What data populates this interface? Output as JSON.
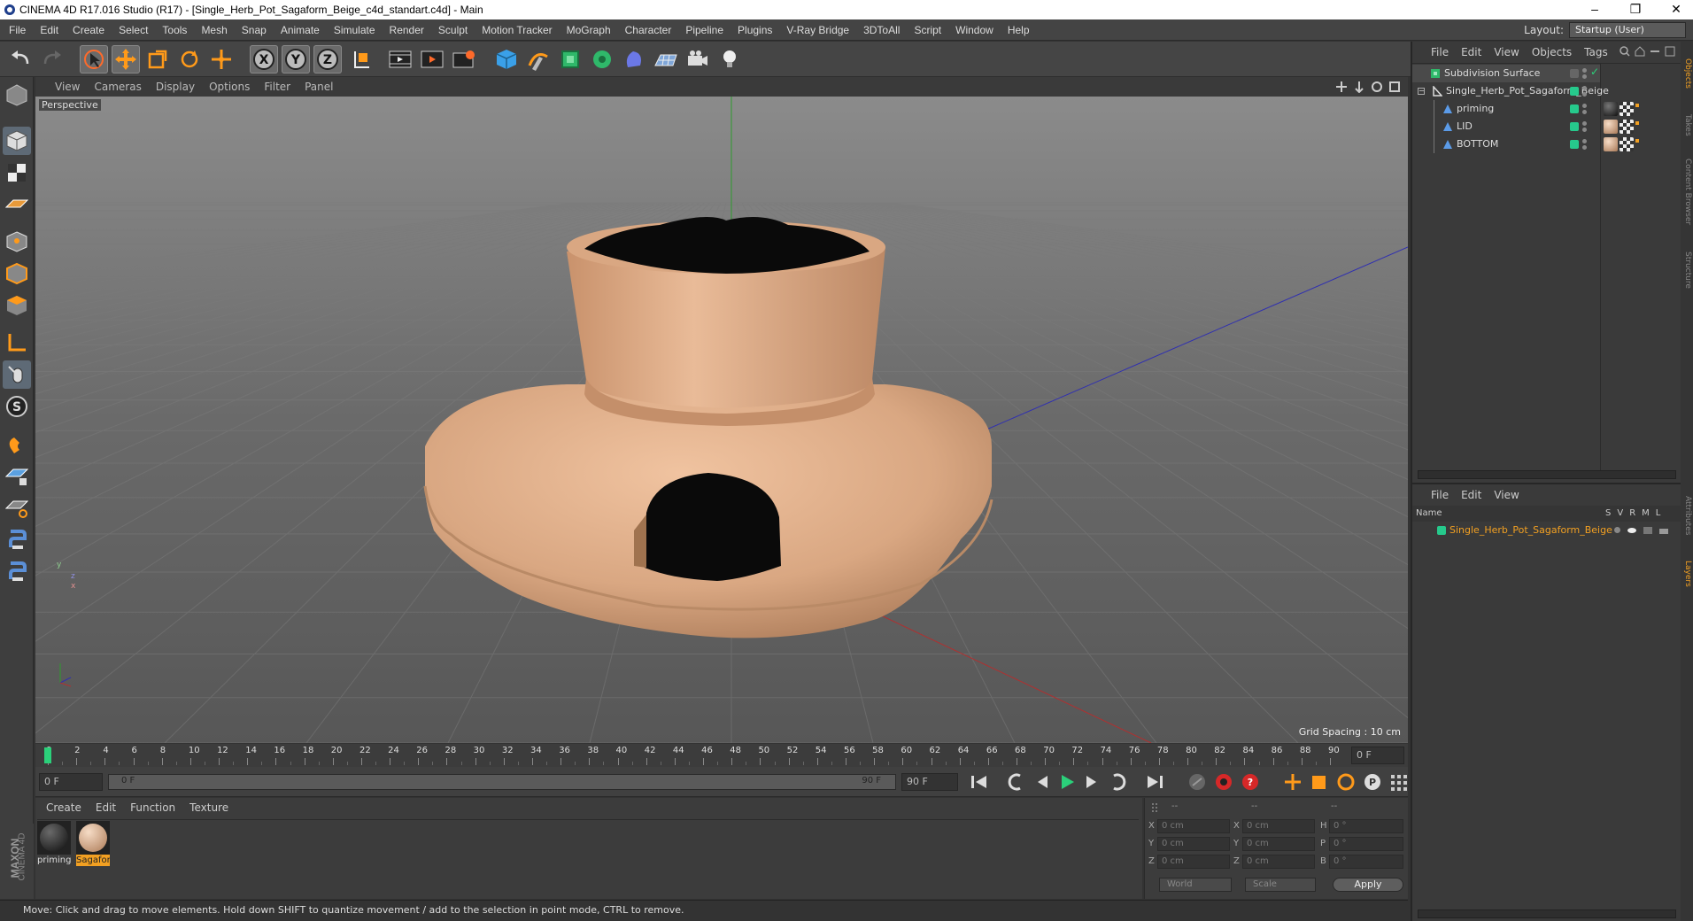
{
  "window": {
    "title": "CINEMA 4D R17.016 Studio (R17) - [Single_Herb_Pot_Sagaform_Beige_c4d_standart.c4d] - Main",
    "minimize": "–",
    "maximize": "❐",
    "close": "✕"
  },
  "menubar": {
    "items": [
      "File",
      "Edit",
      "Create",
      "Select",
      "Tools",
      "Mesh",
      "Snap",
      "Animate",
      "Simulate",
      "Render",
      "Sculpt",
      "Motion Tracker",
      "MoGraph",
      "Character",
      "Pipeline",
      "Plugins",
      "V-Ray Bridge",
      "3DToAll",
      "Script",
      "Window",
      "Help"
    ],
    "layout_label": "Layout:",
    "layout_value": "Startup (User)"
  },
  "viewport": {
    "menu": [
      "View",
      "Cameras",
      "Display",
      "Options",
      "Filter",
      "Panel"
    ],
    "label": "Perspective",
    "grid_spacing": "Grid Spacing : 10 cm",
    "axis_y": "y",
    "axis_z": "z",
    "axis_x": "x"
  },
  "timeline": {
    "ticks": [
      "0",
      "2",
      "4",
      "6",
      "8",
      "10",
      "12",
      "14",
      "16",
      "18",
      "20",
      "22",
      "24",
      "26",
      "28",
      "30",
      "32",
      "34",
      "36",
      "38",
      "40",
      "42",
      "44",
      "46",
      "48",
      "50",
      "52",
      "54",
      "56",
      "58",
      "60",
      "62",
      "64",
      "66",
      "68",
      "70",
      "72",
      "74",
      "76",
      "78",
      "80",
      "82",
      "84",
      "86",
      "88",
      "90"
    ],
    "current_frame": "0 F"
  },
  "transport": {
    "start_field": "0 F",
    "range_start": "0 F",
    "range_end": "90 F",
    "end_field": "90 F"
  },
  "materials": {
    "menu": [
      "Create",
      "Edit",
      "Function",
      "Texture"
    ],
    "items": [
      {
        "name": "priming",
        "selected": false
      },
      {
        "name": "Sagafor",
        "selected": true
      }
    ],
    "logo_line1": "MAXON",
    "logo_line2": "CINEMA 4D"
  },
  "attributes": {
    "header": [
      "--",
      "--",
      "--"
    ],
    "rows": [
      {
        "label": "X",
        "pos": "0 cm",
        "label2": "X",
        "size": "0 cm",
        "label3": "H",
        "rot": "0 °"
      },
      {
        "label": "Y",
        "pos": "0 cm",
        "label2": "Y",
        "size": "0 cm",
        "label3": "P",
        "rot": "0 °"
      },
      {
        "label": "Z",
        "pos": "0 cm",
        "label2": "Z",
        "size": "0 cm",
        "label3": "B",
        "rot": "0 °"
      }
    ],
    "coord_system": "World",
    "mode": "Scale",
    "apply": "Apply"
  },
  "status": {
    "text": "Move: Click and drag to move elements. Hold down SHIFT to quantize movement / add to the selection in point mode, CTRL to remove."
  },
  "object_manager": {
    "menu": [
      "File",
      "Edit",
      "View",
      "Objects",
      "Tags"
    ],
    "objects": [
      {
        "name": "Subdivision Surface",
        "indent": 0
      },
      {
        "name": "Single_Herb_Pot_Sagaform_Beige",
        "indent": 0
      },
      {
        "name": "priming",
        "indent": 1
      },
      {
        "name": "LID",
        "indent": 1
      },
      {
        "name": "BOTTOM",
        "indent": 1
      }
    ]
  },
  "layer_manager": {
    "menu": [
      "File",
      "Edit",
      "View"
    ],
    "col_name": "Name",
    "cols": [
      "S",
      "V",
      "R",
      "M",
      "L"
    ],
    "layer_name": "Single_Herb_Pot_Sagaform_Beige"
  },
  "side_tabs": [
    "Objects",
    "Takes",
    "Content Browser",
    "Structure",
    "Attributes",
    "Layers"
  ],
  "colors": {
    "accent_orange": "#f2a022",
    "layer_green": "#26c98c",
    "pot_beige": "#d9a782"
  },
  "icons": [
    "undo-icon",
    "redo-icon",
    "select-arrow-icon",
    "move-icon",
    "scale-icon",
    "rotate-icon",
    "live-select-icon",
    "x-axis-icon",
    "y-axis-icon",
    "z-axis-icon",
    "coordinate-system-icon",
    "render-view-icon",
    "render-picture-viewer-icon",
    "render-settings-icon",
    "cube-icon",
    "pen-spline-icon",
    "subdivision-icon",
    "cloner-icon",
    "deformer-icon",
    "floor-icon",
    "camera-icon",
    "light-icon"
  ]
}
